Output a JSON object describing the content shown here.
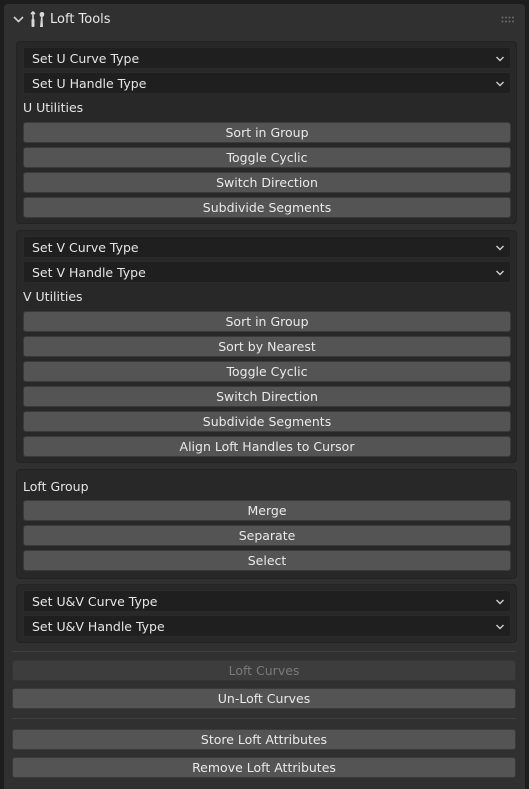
{
  "panel": {
    "title": "Loft Tools"
  },
  "u_box": {
    "curve_type": "Set U Curve Type",
    "handle_type": "Set U Handle Type",
    "utilities_label": "U Utilities",
    "buttons": [
      "Sort in Group",
      "Toggle Cyclic",
      "Switch Direction",
      "Subdivide Segments"
    ]
  },
  "v_box": {
    "curve_type": "Set V Curve Type",
    "handle_type": "Set V Handle Type",
    "utilities_label": "V Utilities",
    "buttons": [
      "Sort in Group",
      "Sort by Nearest",
      "Toggle Cyclic",
      "Switch Direction",
      "Subdivide Segments",
      "Align Loft Handles to Cursor"
    ]
  },
  "group_box": {
    "label": "Loft Group",
    "buttons": [
      "Merge",
      "Separate",
      "Select"
    ]
  },
  "uv_box": {
    "curve_type": "Set U&V Curve Type",
    "handle_type": "Set U&V Handle Type"
  },
  "loft": {
    "loft_curves": "Loft Curves",
    "unloft_curves": "Un-Loft Curves"
  },
  "attributes": {
    "store": "Store Loft Attributes",
    "remove": "Remove Loft Attributes"
  }
}
